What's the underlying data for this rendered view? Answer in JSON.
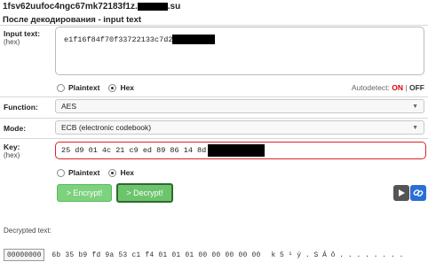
{
  "header": {
    "domain_visible": "1fsv62uufoc4ngc67mk72183f1z.",
    "domain_suffix": ".su",
    "subtitle": "После декодирования - input text"
  },
  "input": {
    "label": "Input text:",
    "sublabel": "(hex)",
    "value": "e1f16f84f70f33722133c7d2"
  },
  "input_format": {
    "option1": "Plaintext",
    "option2": "Hex",
    "selected": "Hex"
  },
  "autodetect": {
    "label": "Autodetect:",
    "on": "ON",
    "sep": "|",
    "off": "OFF"
  },
  "function": {
    "label": "Function:",
    "value": "AES"
  },
  "mode": {
    "label": "Mode:",
    "value": "ECB (electronic codebook)"
  },
  "key": {
    "label": "Key:",
    "sublabel": "(hex)",
    "value": "25 d9 01 4c 21 c9 ed 89 86 14 8d"
  },
  "key_format": {
    "option1": "Plaintext",
    "option2": "Hex",
    "selected": "Hex"
  },
  "buttons": {
    "encrypt": "> Encrypt!",
    "decrypt": "> Decrypt!"
  },
  "output": {
    "label": "Decrypted text:",
    "offset": "00000000",
    "hex": "6b 35 b9 fd 9a 53 c1 f4 01 01 01 00 00 00 00 00",
    "ascii": "k 5 ¹ ý . S Á ô . . . . . . . ."
  },
  "colors": {
    "accent_red": "#dd2222",
    "button_green": "#7dd27d",
    "button_border_dark": "#2e6b2e"
  }
}
